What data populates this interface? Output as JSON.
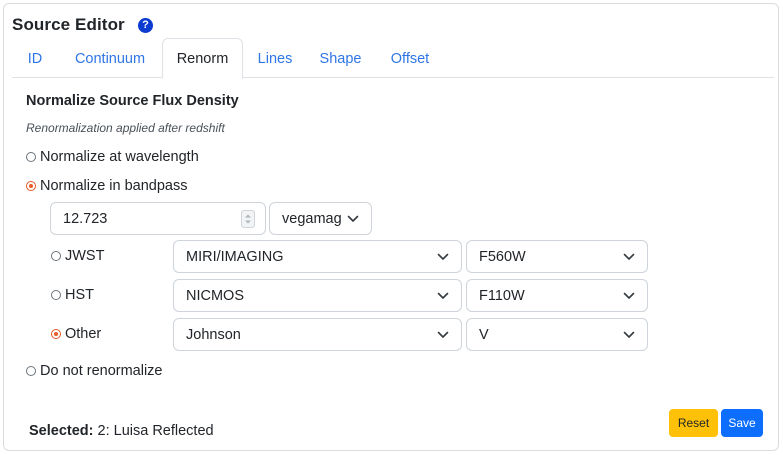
{
  "header": {
    "title": "Source Editor",
    "help_icon": "?"
  },
  "tabs": [
    {
      "label": "ID",
      "active": false
    },
    {
      "label": "Continuum",
      "active": false
    },
    {
      "label": "Renorm",
      "active": true
    },
    {
      "label": "Lines",
      "active": false
    },
    {
      "label": "Shape",
      "active": false
    },
    {
      "label": "Offset",
      "active": false
    }
  ],
  "renorm": {
    "title": "Normalize Source Flux Density",
    "subtitle": "Renormalization applied after redshift",
    "options": {
      "wavelength": {
        "label": "Normalize at wavelength",
        "checked": false
      },
      "bandpass": {
        "label": "Normalize in bandpass",
        "checked": true
      },
      "none": {
        "label": "Do not renormalize",
        "checked": false
      }
    },
    "value": "12.723",
    "unit": "vegamag",
    "bandpass_rows": {
      "jwst": {
        "label": "JWST",
        "checked": false,
        "instrument": "MIRI/IMAGING",
        "filter": "F560W"
      },
      "hst": {
        "label": "HST",
        "checked": false,
        "instrument": "NICMOS",
        "filter": "F110W"
      },
      "other": {
        "label": "Other",
        "checked": true,
        "instrument": "Johnson",
        "filter": "V"
      }
    }
  },
  "footer": {
    "selected_label": "Selected:",
    "selected_value": "2: Luisa Reflected",
    "reset_label": "Reset",
    "save_label": "Save"
  },
  "colors": {
    "accent": "#e8592b",
    "link": "#2f76e6",
    "save": "#0d6efd",
    "reset": "#ffc107",
    "help": "#0b3bd1"
  }
}
